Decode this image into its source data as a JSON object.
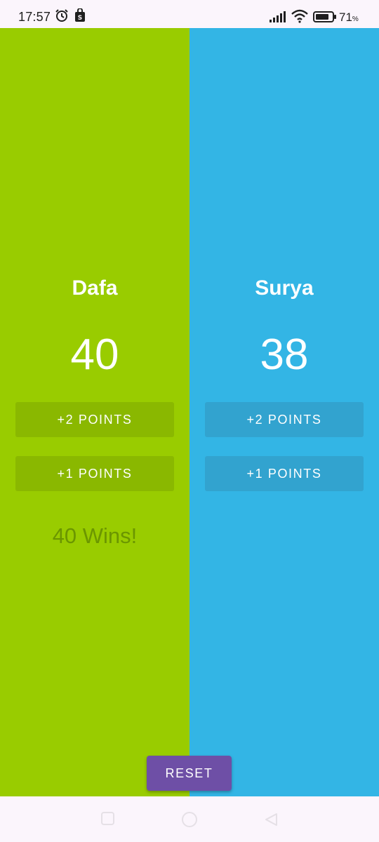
{
  "status_bar": {
    "time": "17:57",
    "battery_percent": "71",
    "battery_unit": "%",
    "icons": [
      "alarm-icon",
      "shopping-bag-icon",
      "signal-icon",
      "wifi-icon",
      "battery-icon"
    ]
  },
  "colors": {
    "team_a_bg": "#99cc00",
    "team_b_bg": "#33b5e5",
    "reset_bg": "#6e4fa6",
    "win_text": "#6b9600"
  },
  "team_a": {
    "name": "Dafa",
    "score": "40",
    "plus_two_label": "+2 POINTS",
    "plus_one_label": "+1 POINTS",
    "win_message": "40 Wins!"
  },
  "team_b": {
    "name": "Surya",
    "score": "38",
    "plus_two_label": "+2 POINTS",
    "plus_one_label": "+1 POINTS"
  },
  "reset_label": "RESET",
  "nav": {
    "icons": [
      "recents-square-icon",
      "home-circle-icon",
      "back-triangle-icon"
    ]
  }
}
